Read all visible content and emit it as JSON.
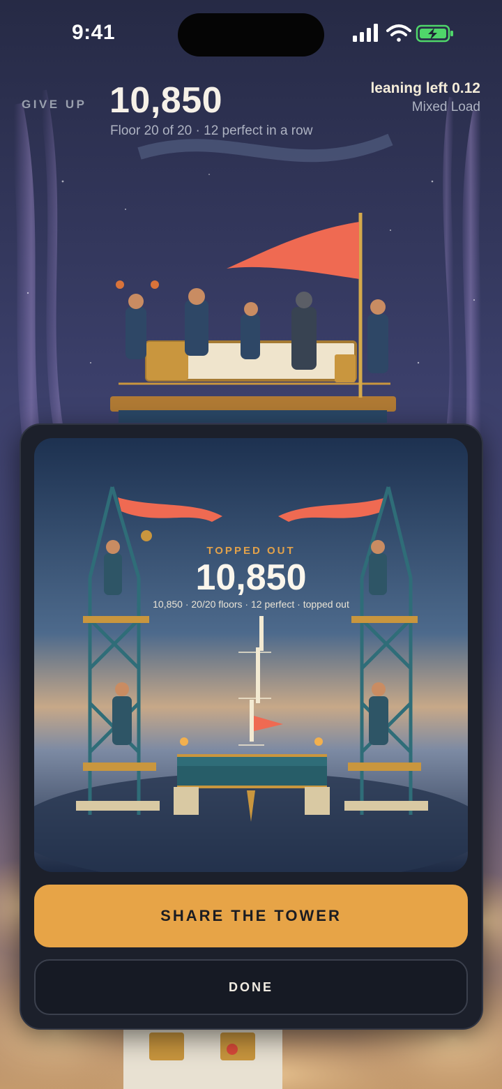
{
  "status_bar": {
    "time": "9:41",
    "icons": [
      "signal-icon",
      "wifi-icon",
      "battery-charging-icon"
    ]
  },
  "hud": {
    "give_up_label": "GIVE UP",
    "score": "10,850",
    "floor_line": "Floor 20 of 20 · 12 perfect in a row",
    "lean_text": "leaning left 0.12",
    "load_text": "Mixed Load"
  },
  "result_card": {
    "heading": "TOPPED OUT",
    "score": "10,850",
    "summary": "10,850 · 20/20 floors · 12 perfect · topped out",
    "share_label": "SHARE THE TOWER",
    "done_label": "DONE"
  },
  "colors": {
    "accent": "#e7a447",
    "card_bg": "#1c202b",
    "flag": "#ef6a52",
    "sky_top": "#2c3150"
  }
}
